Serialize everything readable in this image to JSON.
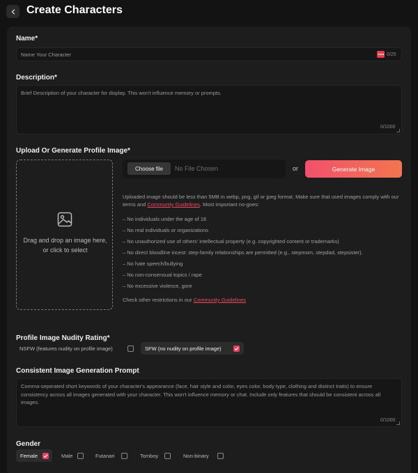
{
  "header": {
    "title": "Create Characters"
  },
  "name_field": {
    "label": "Name*",
    "placeholder": "Name Your Character",
    "counter": "0/25"
  },
  "description_field": {
    "label": "Description*",
    "placeholder": "Brief Description of your character for display. This won't influence memory or prompts.",
    "counter": "0/1000"
  },
  "profile_image": {
    "label": "Upload Or Generate Profile Image*",
    "dropzone_line1": "Drag and drop an image here,",
    "dropzone_line2": "or click to select",
    "choose_file": "Choose file",
    "no_file": "No File Chosen",
    "or": "or",
    "generate": "Generate Image",
    "info_part1": "Uploaded image should be less than 5MB in webp, png, gif or jpeg format. Make sure that used images comply with our terms and",
    "info_link": "Community Guidelines",
    "info_part2": ". Most important no-goes:",
    "rules": [
      "– No individuals under the age of 18",
      "– No real individuals or organizations",
      "– No unauthorized use of others' intellectual property (e.g. copyrighted content or trademarks)",
      "– No direct bloodline incest: step-family relationships are permitted (e.g., stepmom, stepdad, stepsister).",
      "– No hate speech/bullying",
      "– No non-consensual topics / rape",
      "– No excessive violence, gore"
    ],
    "other_restrictions": "Check other restrictions in our",
    "other_link": "Community Guidelines"
  },
  "nudity_rating": {
    "label": "Profile Image Nudity Rating*",
    "nsfw": "NSFW (features nudity on profile image)",
    "sfw": "SFW (no nudity on profile image)",
    "selected": "SFW"
  },
  "consistent_prompt": {
    "label": "Consistent Image Generation Prompt",
    "placeholder": "Comma-seperated short keywords of your character's appearance (face, hair style and color, eyes color, body type, clothing and distinct traits) to ensure consistency across all images generated with your character. This won't influence memory or chat. Include only features that should be consistent across all images.",
    "counter": "0/1000"
  },
  "gender": {
    "label": "Gender",
    "options": [
      "Female",
      "Male",
      "Futanari",
      "Tomboy",
      "Non-binary"
    ],
    "selected": "Female"
  },
  "colors": {
    "accent": "#e8415e",
    "background": "#131313",
    "panel": "#1d1d1d"
  },
  "icons": [
    "chevron-left-icon",
    "more-dots-icon",
    "image-icon",
    "check-icon"
  ]
}
